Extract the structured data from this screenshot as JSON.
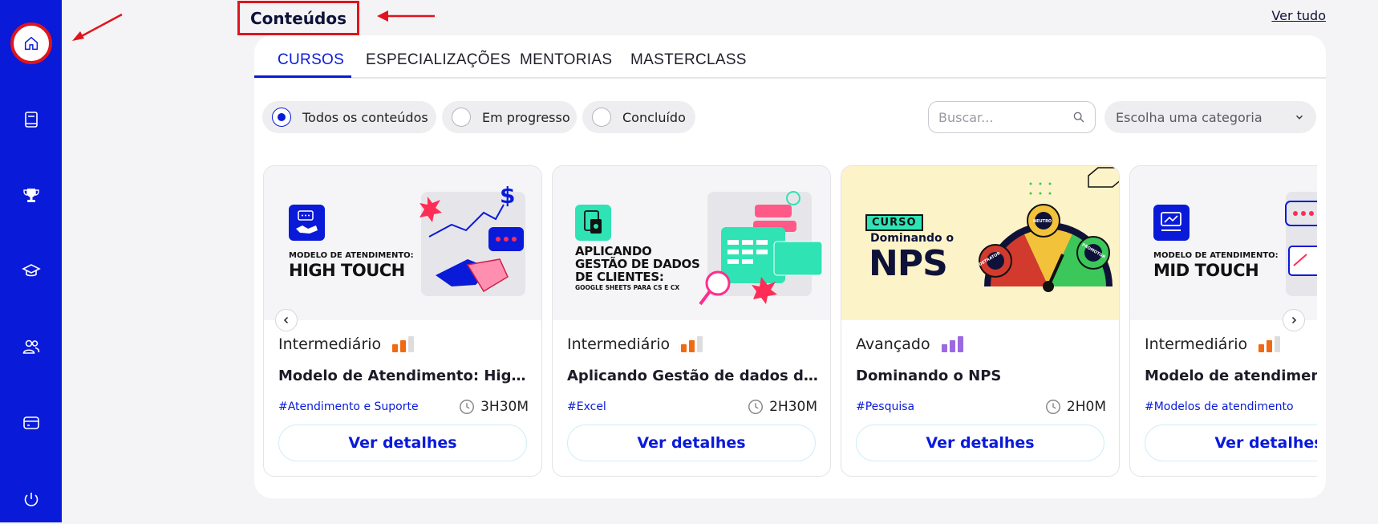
{
  "sidebar": {
    "items": [
      {
        "icon": "home-icon"
      },
      {
        "icon": "book-icon"
      },
      {
        "icon": "trophy-icon"
      },
      {
        "icon": "graduation-cap-icon"
      },
      {
        "icon": "users-icon"
      },
      {
        "icon": "card-icon"
      },
      {
        "icon": "power-icon"
      }
    ]
  },
  "header": {
    "title": "Conteúdos",
    "see_all": "Ver tudo"
  },
  "tabs": [
    {
      "label": "CURSOS",
      "active": true
    },
    {
      "label": "ESPECIALIZAÇÕES",
      "active": false
    },
    {
      "label": "MENTORIAS",
      "active": false
    },
    {
      "label": "MASTERCLASS",
      "active": false
    }
  ],
  "filters": [
    {
      "label": "Todos os conteúdos",
      "checked": true
    },
    {
      "label": "Em progresso",
      "checked": false
    },
    {
      "label": "Concluído",
      "checked": false
    }
  ],
  "search": {
    "placeholder": "Buscar..."
  },
  "category_select": {
    "value": "Escolha uma categoria"
  },
  "cards": [
    {
      "thumb_small": "MODELO DE ATENDIMENTO:",
      "thumb_big": "HIGH TOUCH",
      "level": "Intermediário",
      "level_bars": 2,
      "title": "Modelo de Atendimento: High Touch",
      "tag": "#Atendimento e Suporte",
      "duration": "3H30M",
      "button": "Ver detalhes"
    },
    {
      "thumb_big": "APLICANDO GESTÃO DE DADOS DE CLIENTES:",
      "thumb_small": "GOOGLE SHEETS PARA CS E CX",
      "level": "Intermediário",
      "level_bars": 2,
      "title": "Aplicando Gestão de dados de clientes",
      "tag": "#Excel",
      "duration": "2H30M",
      "button": "Ver detalhes"
    },
    {
      "thumb_label": "CURSO",
      "thumb_small": "Dominando o",
      "thumb_big": "NPS",
      "gauge_detractor": "DETRATOR",
      "gauge_neutral": "NEUTRO",
      "gauge_promoter": "PROMOTOR",
      "level": "Avançado",
      "level_bars": 3,
      "title": "Dominando o NPS",
      "tag": "#Pesquisa",
      "duration": "2H0M",
      "button": "Ver detalhes"
    },
    {
      "thumb_small": "MODELO DE ATENDIMENTO:",
      "thumb_big": "MID TOUCH",
      "level": "Intermediário",
      "level_bars": 2,
      "title": "Modelo de atendimento: Mid Touch",
      "tag": "#Modelos de atendimento",
      "duration": "",
      "button": "Ver detalhes"
    }
  ],
  "colors": {
    "sidebar": "#0a1ad9",
    "accent": "#0a1ad9",
    "annotation": "#e0141c",
    "intermediate_bar": "#f06a14",
    "advanced_bar": "#9b6ae0"
  }
}
